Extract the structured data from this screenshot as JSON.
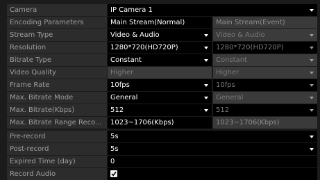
{
  "camera": {
    "label": "Camera",
    "value": "IP Camera 1"
  },
  "encoding": {
    "label": "Encoding Parameters",
    "col1": "Main Stream(Normal)",
    "col2": "Main Stream(Event)"
  },
  "params": [
    {
      "label": "Stream Type",
      "v1": "Video & Audio",
      "v2": "Video & Audio"
    },
    {
      "label": "Resolution",
      "v1": "1280*720(HD720P)",
      "v2": "1280*720(HD720P)"
    },
    {
      "label": "Bitrate Type",
      "v1": "Constant",
      "v2": "Constant"
    },
    {
      "label": "Video Quality",
      "v1": "Higher",
      "v2": "Higher"
    },
    {
      "label": "Frame Rate",
      "v1": "10fps",
      "v2": "10fps"
    },
    {
      "label": "Max. Bitrate Mode",
      "v1": "General",
      "v2": "General"
    },
    {
      "label": "Max. Bitrate(Kbps)",
      "v1": "512",
      "v2": "512"
    },
    {
      "label": "Max. Bitrate Range Reco...",
      "v1": "1023~1706(Kbps)",
      "v2": "1023~1706(Kbps)"
    }
  ],
  "record": {
    "pre_label": "Pre-record",
    "pre_value": "5s",
    "post_label": "Post-record",
    "post_value": "5s",
    "expired_label": "Expired Time (day)",
    "expired_value": "0",
    "audio_label": "Record Audio",
    "audio_checked": true
  },
  "colors": {
    "dropdown_arrow": "#ffffff",
    "disabled_arrow": "#9a9a9a"
  }
}
